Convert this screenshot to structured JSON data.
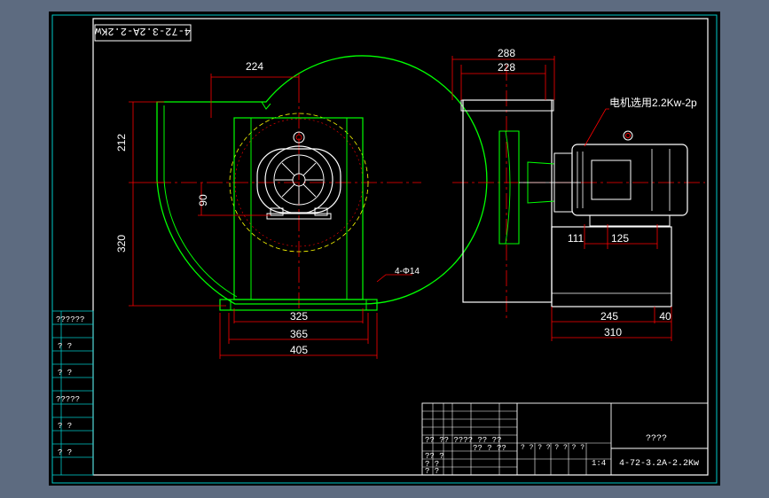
{
  "colors": {
    "background": "#000000",
    "frame": "#5d6b80",
    "border": "#ffffff",
    "title_block": "#00c8c8",
    "dimension": "#ff0000",
    "outline": "#00ff00",
    "motor": "#ffffff",
    "centerline": "#ff0000",
    "dashed": "#ffff00"
  },
  "stamp": {
    "text": "4-72-3.2A-2.2Kw"
  },
  "front_view": {
    "dim_top_width": "224",
    "dim_upper_height": "212",
    "dim_lower_height": "320",
    "dim_shaft_height": "90",
    "dim_bolt_holes": "4-Φ14",
    "dim_base_inner": "325",
    "dim_base_mid": "365",
    "dim_base_outer": "405"
  },
  "side_view": {
    "dim_outer_width": "288",
    "dim_inner_width": "228",
    "motor_note": "电机选用2.2Kw-2p",
    "dim_base_a": "111",
    "dim_base_b": "125",
    "dim_base_c": "245",
    "dim_base_d": "40",
    "dim_base_e": "310"
  },
  "left_table": {
    "rows": [
      "??????",
      "?  ?",
      "?  ?",
      "?????",
      "?  ?",
      "?  ?"
    ]
  },
  "title_block": {
    "drawing_name": "????",
    "model": "4-72-3.2A-2.2Kw",
    "row_labels_a": "?? ??  ????  ??  ??",
    "row_labels_b": "?? ?",
    "row_labels_c": "? ?",
    "row_labels_d": "? ?",
    "mid_labels": "?? ? ??",
    "scale_labels": "? ?  ? ?  ? ?  ? ?",
    "scale_value": "1:4"
  }
}
